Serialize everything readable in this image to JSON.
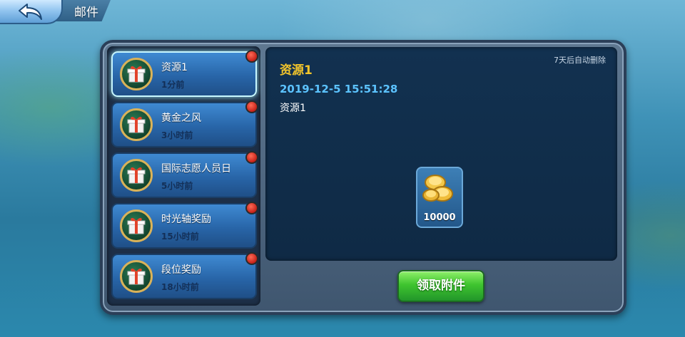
{
  "header": {
    "title": "邮件",
    "back_icon": "back-arrow-icon"
  },
  "mail_list": [
    {
      "title": "资源1",
      "time": "1分前",
      "unread": true,
      "selected": true,
      "icon": "gift-icon"
    },
    {
      "title": "黄金之风",
      "time": "3小时前",
      "unread": true,
      "selected": false,
      "icon": "gift-icon"
    },
    {
      "title": "国际志愿人员日",
      "time": "5小时前",
      "unread": true,
      "selected": false,
      "icon": "gift-icon"
    },
    {
      "title": "时光轴奖励",
      "time": "15小时前",
      "unread": true,
      "selected": false,
      "icon": "gift-icon"
    },
    {
      "title": "段位奖励",
      "time": "18小时前",
      "unread": true,
      "selected": false,
      "icon": "gift-icon"
    }
  ],
  "detail": {
    "title": "资源1",
    "auto_delete_note": "7天后自动删除",
    "date": "2019-12-5 15:51:28",
    "body": "资源1",
    "attachment": {
      "icon": "gold-coins-icon",
      "quantity": "10000"
    }
  },
  "actions": {
    "claim_label": "领取附件"
  },
  "colors": {
    "title_gold": "#f3c52b",
    "date_blue": "#5cc3ff",
    "claim_green": "#3fc42f",
    "unread_red": "#d0261c"
  }
}
